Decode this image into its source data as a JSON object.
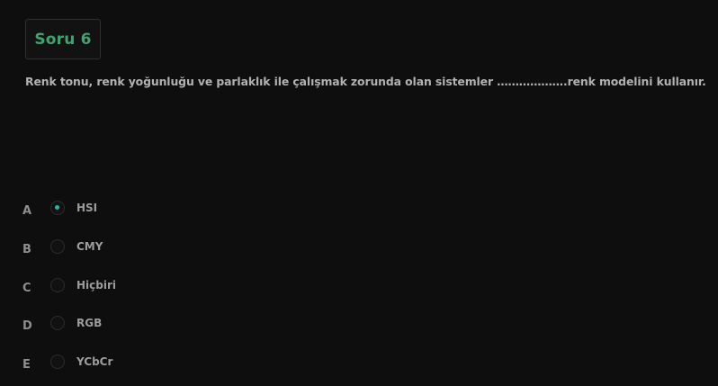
{
  "question": {
    "badge": "Soru 6",
    "text": "Renk tonu, renk yoğunluğu ve parlaklık ile çalışmak zorunda olan sistemler ……………….renk modelini kullanır."
  },
  "options": [
    {
      "letter": "A",
      "label": "HSI",
      "selected": true
    },
    {
      "letter": "B",
      "label": "CMY",
      "selected": false
    },
    {
      "letter": "C",
      "label": "Hiçbiri",
      "selected": false
    },
    {
      "letter": "D",
      "label": "RGB",
      "selected": false
    },
    {
      "letter": "E",
      "label": "YCbCr",
      "selected": false
    }
  ],
  "colors": {
    "background": "#0e0e0e",
    "badge_text": "#3fa36e",
    "radio_selected": "#2bb3a3"
  }
}
